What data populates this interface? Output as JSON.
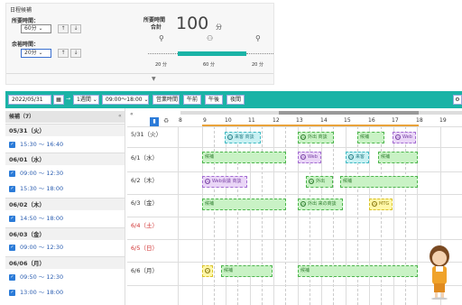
{
  "settings": {
    "title": "日程候補",
    "duration_label": "所要時間：",
    "duration_value": "60分",
    "margin_label": "余裕時間：",
    "margin_value": "20分",
    "total_label_1": "所要時間",
    "total_label_2": "合計",
    "total_value": "100",
    "total_unit": "分",
    "seg_before": "20 分",
    "seg_main": "60 分",
    "seg_after": "20 分",
    "expand_glyph": "▼"
  },
  "toolbar": {
    "date": "2022/05/31",
    "range": "1週間",
    "time_range": "09:00～18:00",
    "btn_weekday": "営業時間",
    "btn_am": "午前",
    "btn_pm": "午後",
    "btn_evening": "夜間",
    "colors": {
      "accent": "#1ab3a6"
    }
  },
  "left": {
    "header": "候補（7）",
    "days": [
      {
        "label": "05/31（火）",
        "slots": [
          "15:30 ～ 16:40"
        ]
      },
      {
        "label": "06/01（水）",
        "slots": [
          "09:00 ～ 12:30",
          "15:30 ～ 18:00"
        ]
      },
      {
        "label": "06/02（木）",
        "slots": [
          "14:50 ～ 18:00"
        ]
      },
      {
        "label": "06/03（金）",
        "slots": [
          "09:00 ～ 12:30"
        ]
      },
      {
        "label": "06/06（月）",
        "slots": [
          "09:50 ～ 12:30",
          "13:00 ～ 18:00"
        ]
      }
    ]
  },
  "grid": {
    "hours": [
      "8",
      "9",
      "10",
      "11",
      "12",
      "13",
      "14",
      "15",
      "16",
      "17",
      "18",
      "19"
    ],
    "days": [
      {
        "label": "5/31（火）",
        "red": false
      },
      {
        "label": "6/1（水）",
        "red": false
      },
      {
        "label": "6/2（木）",
        "red": false
      },
      {
        "label": "6/3（金）",
        "red": false
      },
      {
        "label": "6/4（土）",
        "red": true
      },
      {
        "label": "6/5（日）",
        "red": true
      },
      {
        "label": "6/6（月）",
        "red": false
      }
    ],
    "events": {
      "e1": "来客 商談",
      "e2": "外出 商談",
      "e3": "候補",
      "e4": "Web",
      "e5": "候補",
      "e6": "Web",
      "e7": "来客",
      "e8": "候補",
      "e9": "Web会議 商談",
      "e10": "外出",
      "e11": "候補",
      "e12": "候補",
      "e13": "外出 来の商談",
      "e14": "MTG",
      "e15": "候補",
      "e16": "候補"
    }
  }
}
